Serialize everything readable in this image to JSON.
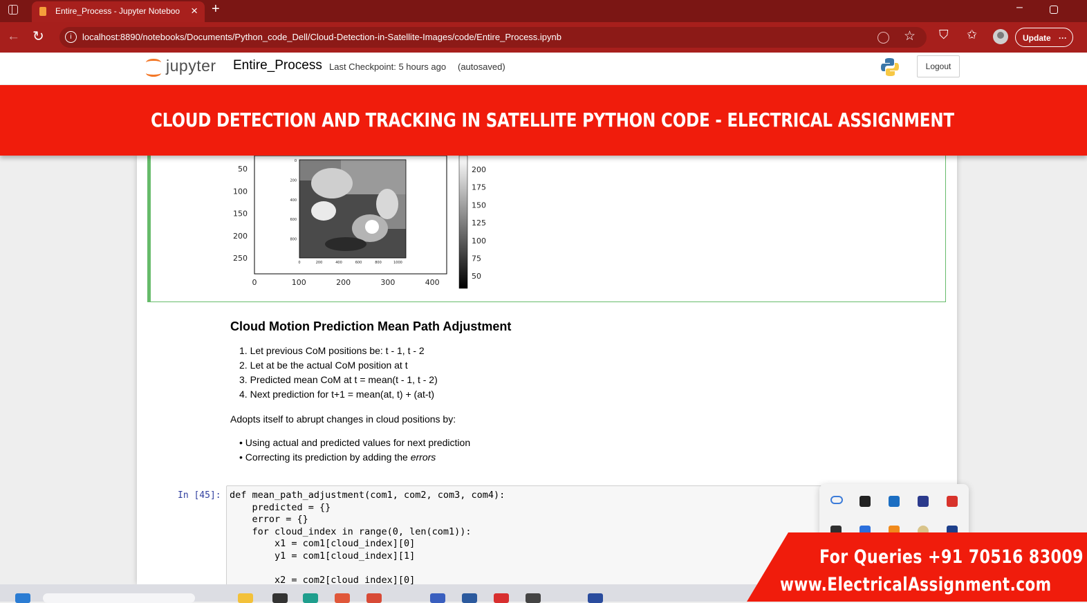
{
  "browser": {
    "tab_title": "Entire_Process - Jupyter Notebook",
    "url": "localhost:8890/notebooks/Documents/Python_code_Dell/Cloud-Detection-in-Satellite-Images/code/Entire_Process.ipynb",
    "update_label": "Update",
    "new_tab_glyph": "+",
    "close_glyph": "×"
  },
  "jupyter": {
    "brand": "jupyter",
    "notebook_name": "Entire_Process",
    "checkpoint": "Last Checkpoint: 5 hours ago",
    "autosaved": "(autosaved)",
    "logout_label": "Logout"
  },
  "banner": {
    "title": "CLOUD DETECTION AND TRACKING IN SATELLITE PYTHON CODE - ELECTRICAL ASSIGNMENT"
  },
  "plot": {
    "y_ticks": [
      "50",
      "100",
      "150",
      "200",
      "250"
    ],
    "x_ticks": [
      "0",
      "100",
      "200",
      "300",
      "400"
    ],
    "inner_y_ticks": [
      "0",
      "200",
      "400",
      "600",
      "800"
    ],
    "inner_x_ticks": [
      "0",
      "200",
      "400",
      "600",
      "800",
      "1000"
    ],
    "colorbar_ticks": [
      "200",
      "175",
      "150",
      "125",
      "100",
      "75",
      "50"
    ]
  },
  "markdown": {
    "heading": "Cloud Motion Prediction Mean Path Adjustment",
    "steps": [
      "Let previous CoM positions be: t - 1, t - 2",
      "Let at be the actual CoM position at t",
      "Predicted mean CoM at t = mean(t - 1, t - 2)",
      "Next prediction for t+1 = mean(at, t) + (at-t)"
    ],
    "intro": "Adopts itself to abrupt changes in cloud positions by:",
    "bullet1": "Using actual and predicted values for next prediction",
    "bullet2_prefix": "Correcting its prediction by adding the ",
    "bullet2_em": "errors"
  },
  "code_cell": {
    "prompt": "In [45]:",
    "lines": [
      "def mean_path_adjustment(com1, com2, com3, com4):",
      "    predicted = {}",
      "    error = {}",
      "    for cloud_index in range(0, len(com1)):",
      "        x1 = com1[cloud_index][0]",
      "        y1 = com1[cloud_index][1]",
      "",
      "        x2 = com2[cloud_index][0]"
    ]
  },
  "contact": {
    "line1": "For Queries +91 70516 83009",
    "line2": "www.ElectricalAssignment.com"
  }
}
